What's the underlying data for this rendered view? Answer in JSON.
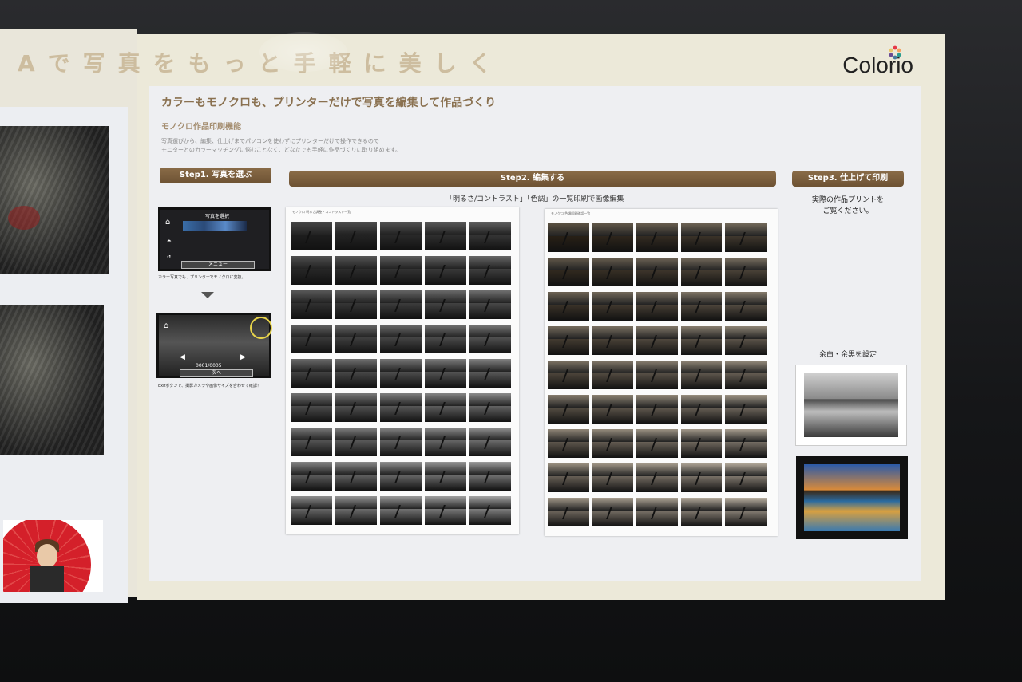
{
  "board": {
    "headline": "Aで写真をもっと手軽に美しく",
    "brand": "Colorio",
    "subtitle": "カラーもモノクロも、プリンターだけで写真を編集して作品づくり",
    "section_label": "モノクロ作品印刷機能",
    "description_line1": "写真選びから、編集、仕上げまでパソコンを使わずにプリンターだけで操作できるので",
    "description_line2": "モニターとのカラーマッチングに悩むことなく、どなたでも手軽に作品づくりに取り組めます。"
  },
  "step1": {
    "label": "Step1. 写真を選ぶ",
    "lcd1_title": "写真を選択",
    "lcd1_button": "メニュー",
    "caption1": "カラー写真でも、プリンターでモノクロに変換。",
    "lcd2_counter": "0001/0005",
    "lcd2_button": "次へ",
    "caption2": "Exifボタンで、撮影カメラや画像サイズを合わせて確認！"
  },
  "step2": {
    "label": "Step2. 編集する",
    "caption": "「明るさ/コントラスト」「色調」の一覧印刷で画像編集",
    "sheet1_header": "モノクロ 明るさ調整・コントラスト一覧",
    "sheet2_header": "モノクロ 色調印刷確認一覧"
  },
  "step3": {
    "label": "Step3. 仕上げて印刷",
    "text_line1": "実際の作品プリントを",
    "text_line2": "ご覧ください。",
    "margin_label": "余白・余黒を設定"
  },
  "colors": {
    "step_bar": "#7a5e3d",
    "board": "#ece9d9",
    "panel": "#eeeff2"
  }
}
